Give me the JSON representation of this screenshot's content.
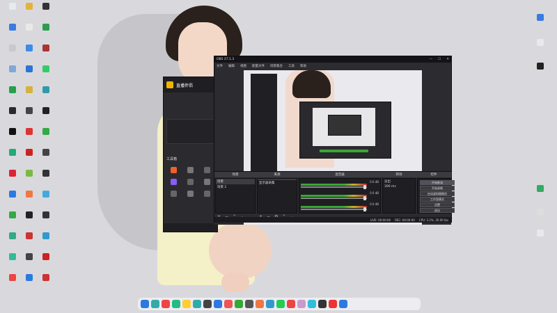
{
  "desktop": {
    "left_icons": [
      {
        "label": "",
        "color": "#e6eaf0"
      },
      {
        "label": "",
        "color": "#e2b33a"
      },
      {
        "label": "",
        "color": "#333"
      },
      {
        "label": "",
        "color": "#3a7be0"
      },
      {
        "label": "",
        "color": "#e9e9ea"
      },
      {
        "label": "",
        "color": "#2f9c4f"
      },
      {
        "label": "",
        "color": "#c9c9cb"
      },
      {
        "label": "",
        "color": "#3c8ce7"
      },
      {
        "label": "",
        "color": "#a33"
      },
      {
        "label": "",
        "color": "#7fa8d9"
      },
      {
        "label": "",
        "color": "#2c74d6"
      },
      {
        "label": "",
        "color": "#3c6"
      },
      {
        "label": "",
        "color": "#25a04b"
      },
      {
        "label": "",
        "color": "#d7b13a"
      },
      {
        "label": "",
        "color": "#39a"
      },
      {
        "label": "",
        "color": "#2a2a2a"
      },
      {
        "label": "",
        "color": "#444"
      },
      {
        "label": "",
        "color": "#222"
      },
      {
        "label": "",
        "color": "#111"
      },
      {
        "label": "",
        "color": "#d33"
      },
      {
        "label": "",
        "color": "#3a4"
      },
      {
        "label": "",
        "color": "#2a7"
      },
      {
        "label": "",
        "color": "#c22"
      },
      {
        "label": "",
        "color": "#444"
      },
      {
        "label": "",
        "color": "#d23"
      },
      {
        "label": "",
        "color": "#7b4"
      },
      {
        "label": "",
        "color": "#333"
      },
      {
        "label": "",
        "color": "#2c7ae0"
      },
      {
        "label": "",
        "color": "#e74"
      },
      {
        "label": "",
        "color": "#4ad"
      },
      {
        "label": "",
        "color": "#3a4"
      },
      {
        "label": "",
        "color": "#222"
      },
      {
        "label": "",
        "color": "#333"
      },
      {
        "label": "",
        "color": "#3a8"
      },
      {
        "label": "",
        "color": "#c33"
      },
      {
        "label": "",
        "color": "#39c"
      },
      {
        "label": "",
        "color": "#3b9"
      },
      {
        "label": "",
        "color": "#444"
      },
      {
        "label": "",
        "color": "#c22"
      },
      {
        "label": "",
        "color": "#e44"
      },
      {
        "label": "",
        "color": "#2c7ae0"
      },
      {
        "label": "",
        "color": "#c33"
      }
    ],
    "right_icons": [
      {
        "label": "",
        "color": "#3a7be0"
      },
      {
        "label": "",
        "color": "#e9e9ea"
      },
      {
        "label": "",
        "color": "#222"
      },
      {
        "label": "",
        "color": "#3a6"
      },
      {
        "label": "",
        "color": "#ddd"
      },
      {
        "label": "",
        "color": "#e8e8ef"
      }
    ]
  },
  "helper_app": {
    "title": "直播伴侣",
    "version": "",
    "tabs": [
      "",
      "",
      ""
    ],
    "section_label": "工具箱",
    "tools": [
      {
        "label": "",
        "color": "#f25f2a"
      },
      {
        "label": "",
        "color": "#777"
      },
      {
        "label": "",
        "color": "#666"
      },
      {
        "label": "",
        "color": "#8b5cf6"
      },
      {
        "label": "",
        "color": "#666"
      },
      {
        "label": "",
        "color": "#777"
      },
      {
        "label": "",
        "color": "#666"
      },
      {
        "label": "",
        "color": "#777"
      },
      {
        "label": "",
        "color": "#666"
      }
    ],
    "footer": ""
  },
  "obs": {
    "title": "OBS 27.1.3",
    "menu": [
      "文件",
      "编辑",
      "视图",
      "配置文件",
      "场景集合",
      "工具",
      "帮助"
    ],
    "window_buttons": [
      "—",
      "☐",
      "✕"
    ],
    "docks": {
      "scenes_title": "场景",
      "sources_title": "来源",
      "mixer_title": "混音器",
      "transitions_title": "转场",
      "controls_title": "控件"
    },
    "scenes": [
      "场景",
      "场景 2"
    ],
    "sources": [
      "",
      "显示器采集"
    ],
    "mixer_rows": [
      {
        "name": "",
        "db": "0.0 dB"
      },
      {
        "name": "",
        "db": "0.0 dB"
      },
      {
        "name": "",
        "db": "0.0 dB"
      }
    ],
    "transition": {
      "value": "淡出",
      "duration": "300 ms"
    },
    "controls": [
      "开始推流",
      "开始录制",
      "启动虚拟摄像机",
      "工作室模式",
      "设置",
      "退出"
    ],
    "status": [
      "LIVE: 00:00:00",
      "REC: 00:00:00",
      "CPU: 3.2%, 30.00 fps"
    ]
  },
  "taskbar": {
    "icons": [
      {
        "color": "#2c7ae0"
      },
      {
        "color": "#3aa"
      },
      {
        "color": "#e44"
      },
      {
        "color": "#2b8"
      },
      {
        "color": "#fc3"
      },
      {
        "color": "#3aa"
      },
      {
        "color": "#444"
      },
      {
        "color": "#2c7ae0"
      },
      {
        "color": "#e55"
      },
      {
        "color": "#3a3"
      },
      {
        "color": "#555"
      },
      {
        "color": "#e74"
      },
      {
        "color": "#39c"
      },
      {
        "color": "#2c5"
      },
      {
        "color": "#e44"
      },
      {
        "color": "#c9c"
      },
      {
        "color": "#3bd"
      },
      {
        "color": "#333"
      },
      {
        "color": "#e33"
      },
      {
        "color": "#2c7ae0"
      }
    ]
  }
}
